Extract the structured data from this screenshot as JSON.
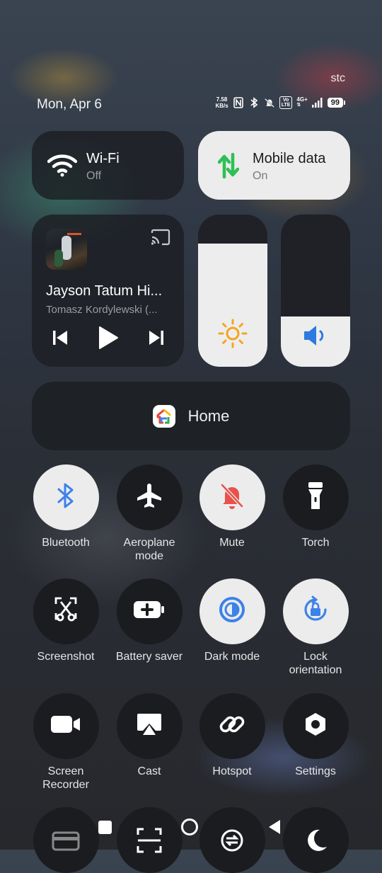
{
  "status_bar": {
    "carrier": "stc",
    "date": "Mon, Apr 6",
    "net_speed_value": "7.58",
    "net_speed_unit": "KB/s",
    "volte_top": "Vo",
    "volte_bottom": "LTE",
    "network_type": "4G+",
    "battery_level": "99",
    "icons": [
      "nfc-icon",
      "bluetooth-icon",
      "vibrate-mute-icon",
      "volte-icon",
      "signal-icon",
      "battery-icon"
    ]
  },
  "wifi_tile": {
    "title": "Wi-Fi",
    "status": "Off"
  },
  "mobile_data_tile": {
    "title": "Mobile data",
    "status": "On",
    "icon_color": "#2fbf55"
  },
  "media_player": {
    "title": "Jayson Tatum Hi...",
    "artist": "Tomasz Kordylewski (..."
  },
  "sliders": {
    "brightness": {
      "level": 0.81,
      "icon_color": "#f4a521"
    },
    "volume": {
      "level": 0.33,
      "icon_color": "#2b7be0"
    }
  },
  "home_tile": {
    "label": "Home"
  },
  "quick_settings": [
    {
      "label": "Bluetooth",
      "state": "on",
      "icon": "bluetooth-icon"
    },
    {
      "label": "Aeroplane mode",
      "state": "off",
      "icon": "airplane-icon"
    },
    {
      "label": "Mute",
      "state": "on",
      "icon": "bell-off-icon"
    },
    {
      "label": "Torch",
      "state": "off",
      "icon": "flashlight-icon"
    },
    {
      "label": "Screenshot",
      "state": "off",
      "icon": "screenshot-icon"
    },
    {
      "label": "Battery saver",
      "state": "off",
      "icon": "battery-saver-icon"
    },
    {
      "label": "Dark mode",
      "state": "on",
      "icon": "dark-mode-icon"
    },
    {
      "label": "Lock orientation",
      "state": "on",
      "icon": "rotation-lock-icon"
    },
    {
      "label": "Screen Recorder",
      "state": "off",
      "icon": "video-camera-icon"
    },
    {
      "label": "Cast",
      "state": "off",
      "icon": "cast-icon"
    },
    {
      "label": "Hotspot",
      "state": "off",
      "icon": "hotspot-icon"
    },
    {
      "label": "Settings",
      "state": "off",
      "icon": "settings-icon"
    }
  ],
  "colors": {
    "accent_blue": "#3c82ea",
    "mute_red": "#e8524a",
    "active_tile": "#ececec"
  },
  "nav_bar": [
    "recents-button",
    "home-button",
    "back-button"
  ]
}
